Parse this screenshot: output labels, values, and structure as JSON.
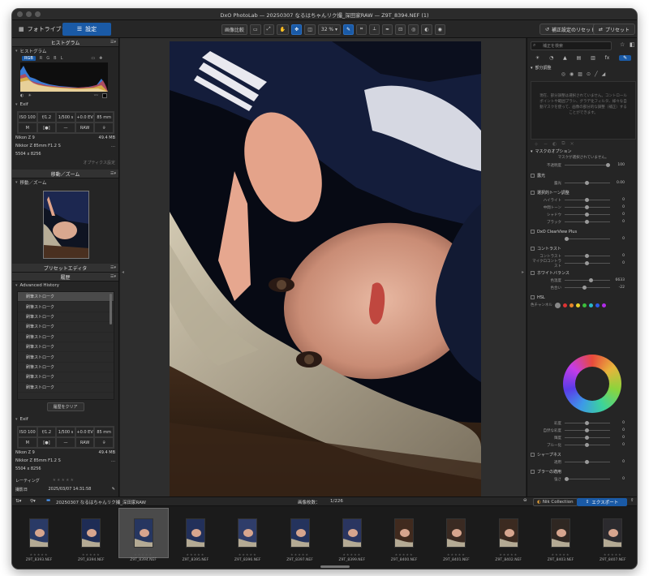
{
  "window": {
    "title": "DxO PhotoLab — 20250307 なるはちゃんリク撮_深田家RAW — Z9T_8394.NEF (1)"
  },
  "toolbar": {
    "library_tab": "フォトライブラリ",
    "edit_tab": "設定",
    "compare_label": "画像比較",
    "zoom_value": "32 %",
    "reset_label": "補正設定のリセット",
    "preset_label": "プリセット"
  },
  "left_panel": {
    "histogram_header": "ヒストグラム",
    "histogram_sub": "ヒストグラム",
    "channels": [
      "RGB",
      "R",
      "G",
      "B",
      "L"
    ],
    "exif_header": "Exif",
    "exif_values": [
      "ISO 100",
      "f/1.2",
      "1/500 s",
      "+0.0 EV",
      "85 mm",
      "M",
      "",
      "—",
      "RAW",
      ""
    ],
    "camera": "Nikon Z 9",
    "file_size": "49.4 MB",
    "lens": "Nikkor Z 85mm F1.2 S",
    "dimensions": "5504 x 8256",
    "optics_note": "オプティクス設定",
    "move_zoom_header": "移動／ズーム",
    "move_zoom_sub": "移動／ズーム",
    "preset_editor_header": "プリセットエディタ",
    "history_header": "履歴",
    "advanced_history": "Advanced History",
    "history_items": [
      "刷筆ストローク",
      "刷筆ストローク",
      "刷筆ストローク",
      "刷筆ストローク",
      "刷筆ストローク",
      "刷筆ストローク",
      "刷筆ストローク",
      "刷筆ストローク",
      "刷筆ストローク",
      "刷筆ストローク"
    ],
    "clear_history": "履歴をクリア",
    "exif2_header": "Exif",
    "exif2_values": [
      "ISO 100",
      "f/1.2",
      "1/500 s",
      "+0.0 EV",
      "85 mm",
      "M",
      "",
      "—",
      "RAW",
      ""
    ],
    "camera2": "Nikon Z 9",
    "file_size2": "49.4 MB",
    "lens2": "Nikkor Z 85mm F1.2 S",
    "dimensions2": "5504 x 8256",
    "rating_label": "レーティング",
    "date_label": "撮影日",
    "date_value": "2025/03/07 14:31:58"
  },
  "right_panel": {
    "search_placeholder": "補正を検索",
    "local_adjust": "部分調整",
    "hint": "現在、部分調整は選択されていません。コントロールポイントや範囲ブラシ、グラデ化フィルタ、様々な自動マスクを使って、画像の部分的な調整（補正）することができます。",
    "mask_options": "マスクのオプション",
    "mask_none": "マスクが選択されていません。",
    "opacity_label": "不透明度",
    "opacity_value": "100",
    "exposure_head": "露光",
    "exposure_label": "露光",
    "exposure_value": "0.00",
    "tone_head": "選択的トーン調整",
    "tone_rows": [
      {
        "label": "ハイライト",
        "value": "0"
      },
      {
        "label": "中間トーン",
        "value": "0"
      },
      {
        "label": "シャドウ",
        "value": "0"
      },
      {
        "label": "ブラック",
        "value": "0"
      }
    ],
    "clearview_head": "DxO ClearView Plus",
    "clearview_value": "0",
    "contrast_head": "コントラスト",
    "contrast_rows": [
      {
        "label": "コントラスト",
        "value": "0"
      },
      {
        "label": "マイクロコントラスト",
        "value": "0"
      }
    ],
    "wb_head": "ホワイトバランス",
    "wb_rows": [
      {
        "label": "色温度",
        "value": "6633"
      },
      {
        "label": "色合い",
        "value": "-22"
      }
    ],
    "hsl_head": "HSL",
    "hsl_channel_label": "色チャンネル",
    "hsl_rows": [
      {
        "label": "彩度",
        "value": "0"
      },
      {
        "label": "自然な彩度",
        "value": "0"
      },
      {
        "label": "輝度",
        "value": "0"
      },
      {
        "label": "ブルー化",
        "value": "0"
      }
    ],
    "sharp_head": "シャープネス",
    "sharp_row": {
      "label": "適用",
      "value": "0"
    },
    "blur_head": "ブラーの適用",
    "blur_row": {
      "label": "強さ",
      "value": "0"
    }
  },
  "filmbar": {
    "folder": "20250307 なるはちゃんリク撮_深田家RAW",
    "count_label": "画像枚数：",
    "count_value": "1/226",
    "nik_label": "Nik Collection",
    "export_label": "エクスポート"
  },
  "filmstrip": [
    {
      "name": "Z9T_8393.NEF"
    },
    {
      "name": "Z9T_8394.NEF"
    },
    {
      "name": "Z9T_8394.NEF"
    },
    {
      "name": "Z9T_8395.NEF"
    },
    {
      "name": "Z9T_8396.NEF"
    },
    {
      "name": "Z9T_8397.NEF"
    },
    {
      "name": "Z9T_8399.NEF"
    },
    {
      "name": "Z9T_8400.NEF"
    },
    {
      "name": "Z9T_8401.NEF"
    },
    {
      "name": "Z9T_8402.NEF"
    },
    {
      "name": "Z9T_8403.NEF"
    },
    {
      "name": "Z9T_8407.NEF"
    }
  ],
  "colors": {
    "accent": "#1a5aa6",
    "panel": "#252525",
    "viewer": "#2e2e2e"
  }
}
